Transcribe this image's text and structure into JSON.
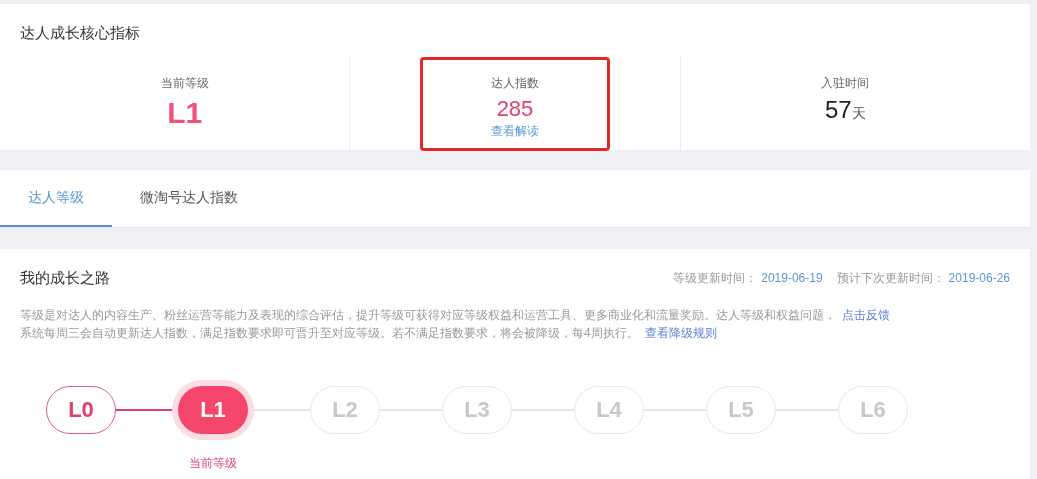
{
  "core_metrics": {
    "title": "达人成长核心指标",
    "metrics": [
      {
        "kind": "level",
        "label": "当前等级",
        "value": "L1"
      },
      {
        "kind": "index",
        "label": "达人指数",
        "value": "285",
        "link": "查看解读",
        "highlighted": true
      },
      {
        "kind": "days",
        "label": "入驻时间",
        "value": "57",
        "unit": "天"
      }
    ]
  },
  "tabs": [
    {
      "label": "达人等级",
      "selected": true
    },
    {
      "label": "微淘号达人指数",
      "selected": false
    }
  ],
  "growth": {
    "title": "我的成长之路",
    "update_label": "等级更新时间：",
    "update_date": "2019-06-19",
    "next_label": "预计下次更新时间：",
    "next_date": "2019-06-26",
    "paragraphs": [
      {
        "text": "等级是对达人的内容生产、粉丝运营等能力及表现的综合评估，提升等级可获得对应等级权益和运营工具、更多商业化和流量奖励。达人等级和权益问题，",
        "link": "点击反馈"
      },
      {
        "text": "系统每周三会自动更新达人指数，满足指数要求即可晋升至对应等级。若不满足指数要求，将会被降级，每4周执行。",
        "link": "查看降级规则"
      }
    ],
    "levels": [
      {
        "label": "L0",
        "kind": "passed"
      },
      {
        "label": "L1",
        "kind": "current",
        "caption": "当前等级"
      },
      {
        "label": "L2",
        "kind": "locked"
      },
      {
        "label": "L3",
        "kind": "locked"
      },
      {
        "label": "L4",
        "kind": "locked"
      },
      {
        "label": "L5",
        "kind": "locked"
      },
      {
        "label": "L6",
        "kind": "locked"
      }
    ]
  }
}
